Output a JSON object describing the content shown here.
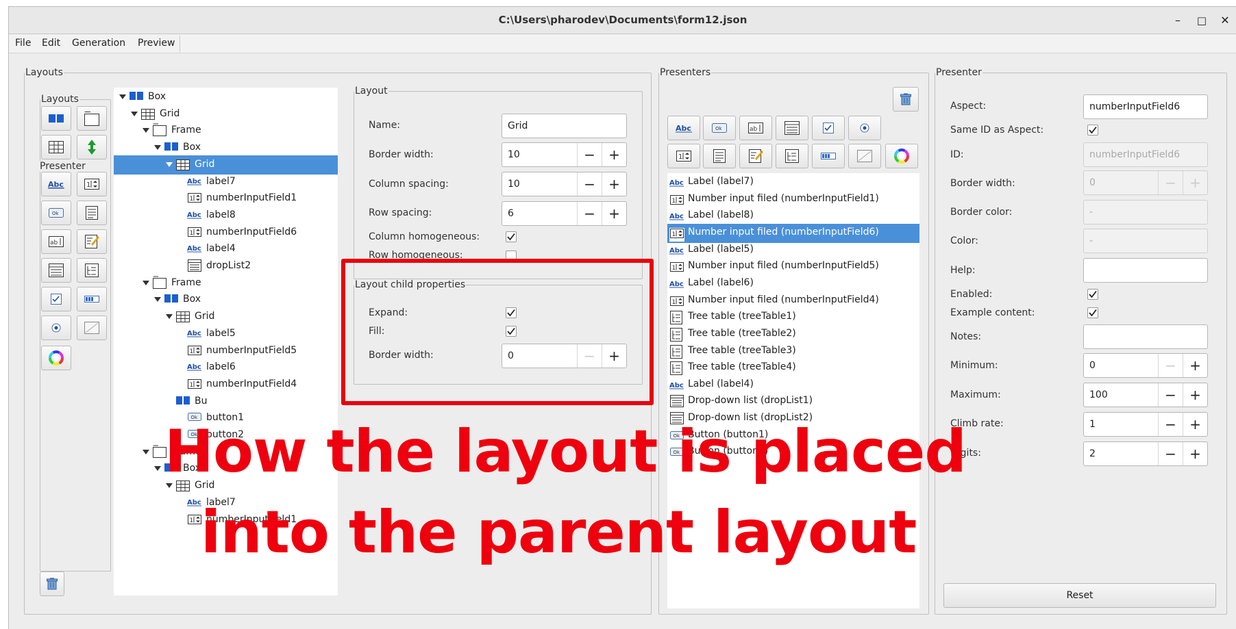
{
  "window": {
    "title": "C:\\Users\\pharodev\\Documents\\form12.json",
    "minimize": "–",
    "maximize": "□",
    "close": "✕"
  },
  "menu": [
    "File",
    "Edit",
    "Generation",
    "Preview"
  ],
  "layouts_group": {
    "title": "Layouts",
    "toolbox_layouts_label": "Layouts",
    "toolbox_presenter_label": "Presenter"
  },
  "tree": [
    {
      "label": "Box",
      "icon": "box-icon",
      "depth": 0,
      "expanded": true
    },
    {
      "label": "Grid",
      "icon": "grid-icon",
      "depth": 1,
      "expanded": true
    },
    {
      "label": "Frame",
      "icon": "frame-icon",
      "depth": 2,
      "expanded": true
    },
    {
      "label": "Box",
      "icon": "box-icon",
      "depth": 3,
      "expanded": true
    },
    {
      "label": "Grid",
      "icon": "grid-icon",
      "depth": 4,
      "expanded": true,
      "selected": true
    },
    {
      "label": "label7",
      "icon": "label-icon",
      "depth": 5
    },
    {
      "label": "numberInputField1",
      "icon": "number-input-icon",
      "depth": 5
    },
    {
      "label": "label8",
      "icon": "label-icon",
      "depth": 5
    },
    {
      "label": "numberInputField6",
      "icon": "number-input-icon",
      "depth": 5
    },
    {
      "label": "label4",
      "icon": "label-icon",
      "depth": 5
    },
    {
      "label": "dropList2",
      "icon": "dropdown-list-icon",
      "depth": 5
    },
    {
      "label": "Frame",
      "icon": "frame-icon",
      "depth": 2,
      "expanded": true
    },
    {
      "label": "Box",
      "icon": "box-icon",
      "depth": 3,
      "expanded": true
    },
    {
      "label": "Grid",
      "icon": "grid-icon",
      "depth": 4,
      "expanded": true
    },
    {
      "label": "label5",
      "icon": "label-icon",
      "depth": 5
    },
    {
      "label": "numberInputField5",
      "icon": "number-input-icon",
      "depth": 5
    },
    {
      "label": "label6",
      "icon": "label-icon",
      "depth": 5
    },
    {
      "label": "numberInputField4",
      "icon": "number-input-icon",
      "depth": 5
    },
    {
      "label": "Bu",
      "icon": "box-icon",
      "depth": 4
    },
    {
      "label": "button1",
      "icon": "button-icon",
      "depth": 5
    },
    {
      "label": "button2",
      "icon": "button-icon",
      "depth": 5
    },
    {
      "label": "Frame",
      "icon": "frame-icon",
      "depth": 2,
      "expanded": true
    },
    {
      "label": "Box",
      "icon": "box-icon",
      "depth": 3,
      "expanded": true
    },
    {
      "label": "Grid",
      "icon": "grid-icon",
      "depth": 4,
      "expanded": true
    },
    {
      "label": "label7",
      "icon": "label-icon",
      "depth": 5
    },
    {
      "label": "numberInputField1",
      "icon": "number-input-icon",
      "depth": 5
    }
  ],
  "layout": {
    "title": "Layout",
    "name_label": "Name:",
    "name_value": "Grid",
    "border_width_label": "Border width:",
    "border_width_value": "10",
    "column_spacing_label": "Column spacing:",
    "column_spacing_value": "10",
    "row_spacing_label": "Row spacing:",
    "row_spacing_value": "6",
    "column_homogeneous_label": "Column homogeneous:",
    "column_homogeneous": true,
    "row_homogeneous_label": "Row homogeneous:",
    "row_homogeneous": false
  },
  "child_props": {
    "title": "Layout child properties",
    "expand_label": "Expand:",
    "expand": true,
    "fill_label": "Fill:",
    "fill": true,
    "border_width_label": "Border width:",
    "border_width_value": "0"
  },
  "spin": {
    "minus": "−",
    "plus": "+"
  },
  "presenters": {
    "title": "Presenters",
    "items": [
      {
        "label": "Label (label7)",
        "icon": "label-icon"
      },
      {
        "label": "Number input filed (numberInputField1)",
        "icon": "number-input-icon"
      },
      {
        "label": "Label (label8)",
        "icon": "label-icon"
      },
      {
        "label": "Number input filed (numberInputField6)",
        "icon": "number-input-icon",
        "selected": true
      },
      {
        "label": "Label (label5)",
        "icon": "label-icon"
      },
      {
        "label": "Number input filed (numberInputField5)",
        "icon": "number-input-icon"
      },
      {
        "label": "Label (label6)",
        "icon": "label-icon"
      },
      {
        "label": "Number input filed (numberInputField4)",
        "icon": "number-input-icon"
      },
      {
        "label": "Tree table (treeTable1)",
        "icon": "tree-table-icon"
      },
      {
        "label": "Tree table (treeTable2)",
        "icon": "tree-table-icon"
      },
      {
        "label": "Tree table (treeTable3)",
        "icon": "tree-table-icon"
      },
      {
        "label": "Tree table (treeTable4)",
        "icon": "tree-table-icon"
      },
      {
        "label": "Label (label4)",
        "icon": "label-icon"
      },
      {
        "label": "Drop-down list (dropList1)",
        "icon": "dropdown-list-icon"
      },
      {
        "label": "Drop-down list (dropList2)",
        "icon": "dropdown-list-icon"
      },
      {
        "label": "Button (button1)",
        "icon": "button-icon"
      },
      {
        "label": "Button (button2)",
        "icon": "button-icon"
      }
    ]
  },
  "presenter": {
    "title": "Presenter",
    "aspect_label": "Aspect:",
    "aspect_value": "numberInputField6",
    "same_id_label": "Same ID as Aspect:",
    "same_id": true,
    "id_label": "ID:",
    "id_value": "numberInputField6",
    "border_width_label": "Border width:",
    "border_width_value": "0",
    "border_color_label": "Border color:",
    "border_color_value": "-",
    "color_label": "Color:",
    "color_value": "-",
    "help_label": "Help:",
    "help_value": "",
    "enabled_label": "Enabled:",
    "enabled": true,
    "example_content_label": "Example content:",
    "example_content": true,
    "notes_label": "Notes:",
    "notes_value": "",
    "minimum_label": "Minimum:",
    "minimum_value": "0",
    "maximum_label": "Maximum:",
    "maximum_value": "100",
    "climb_rate_label": "Climb rate:",
    "climb_rate_value": "1",
    "digits_label": "Digits:",
    "digits_value": "2",
    "reset_label": "Reset"
  },
  "overlay": {
    "line1": "How the layout is placed",
    "line2": "into the parent layout"
  },
  "colors": {
    "selection": "#4a90d9",
    "overlay_red": "#ee000e",
    "box_icon_blue": "#1b5fd1"
  }
}
